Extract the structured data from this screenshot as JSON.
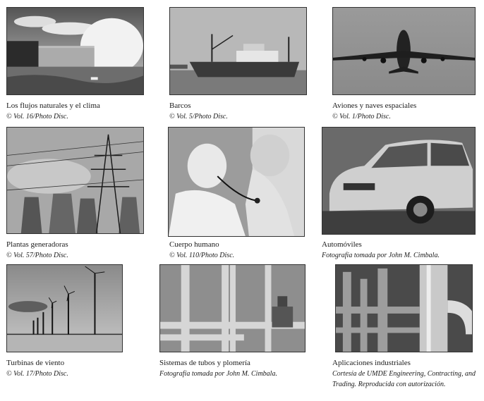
{
  "figures": [
    {
      "title": "Los flujos naturales y el clima",
      "credit": "© Vol. 16/Photo Disc.",
      "image": "waterfall-photo"
    },
    {
      "title": "Barcos",
      "credit": "© Vol. 5/Photo Disc.",
      "image": "ship-photo"
    },
    {
      "title": "Aviones y naves espaciales",
      "credit": "© Vol. 1/Photo Disc.",
      "image": "airplane-photo"
    },
    {
      "title": "Plantas generadoras",
      "credit": "© Vol. 57/Photo Disc.",
      "image": "power-plant-photo"
    },
    {
      "title": "Cuerpo humano",
      "credit": "© Vol. 110/Photo Disc.",
      "image": "doctor-child-photo"
    },
    {
      "title": "Automóviles",
      "credit": "Fotografía tomada por John M. Cimbala.",
      "image": "car-photo"
    },
    {
      "title": "Turbinas de viento",
      "credit": "© Vol. 17/Photo Disc.",
      "image": "wind-turbines-photo"
    },
    {
      "title": "Sistemas de tubos y plomería",
      "credit": "Fotografía tomada por John M. Cimbala.",
      "image": "pipes-photo"
    },
    {
      "title": "Aplicaciones industriales",
      "credit": "Cortesía de UMDE Engineering, Contracting, and Trading. Reproducida con autorización.",
      "image": "industrial-photo"
    }
  ]
}
